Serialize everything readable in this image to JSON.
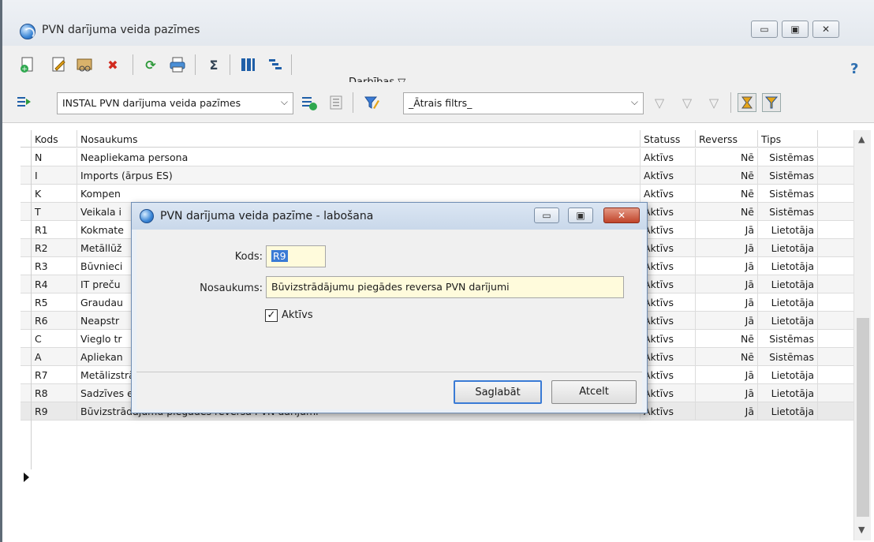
{
  "window": {
    "title": "PVN darījuma veida pazīmes",
    "controls": [
      "minimize",
      "maximize",
      "close"
    ]
  },
  "toolbar1": {
    "tools": [
      "add-icon",
      "edit-icon",
      "copy-icon",
      "delete-icon",
      "refresh-icon",
      "print-icon",
      "sum-icon",
      "columns-icon",
      "tree-icon"
    ],
    "actions_label": "Darbības ▽",
    "help": "?"
  },
  "toolbar2": {
    "view_select": "INSTAL PVN darījuma veida pazīmes",
    "quick_filter": "_Ātrais filtrs_"
  },
  "table": {
    "columns": [
      "Kods",
      "Nosaukums",
      "Statuss",
      "Reverss",
      "Tips"
    ],
    "rows": [
      {
        "kods": "N",
        "nosaukums": "Neapliekama persona",
        "statuss": "Aktīvs",
        "reverss": "Nē",
        "tips": "Sistēmas"
      },
      {
        "kods": "I",
        "nosaukums": "Imports (ārpus ES)",
        "statuss": "Aktīvs",
        "reverss": "Nē",
        "tips": "Sistēmas"
      },
      {
        "kods": "K",
        "nosaukums": "Kompen",
        "statuss": "Aktīvs",
        "reverss": "Nē",
        "tips": "Sistēmas"
      },
      {
        "kods": "T",
        "nosaukums": "Veikala i",
        "statuss": "Aktīvs",
        "reverss": "Nē",
        "tips": "Sistēmas"
      },
      {
        "kods": "R1",
        "nosaukums": "Kokmate",
        "statuss": "Aktīvs",
        "reverss": "Jā",
        "tips": "Lietotāja"
      },
      {
        "kods": "R2",
        "nosaukums": "Metāllūž",
        "statuss": "Aktīvs",
        "reverss": "Jā",
        "tips": "Lietotāja"
      },
      {
        "kods": "R3",
        "nosaukums": "Būvnieci",
        "statuss": "Aktīvs",
        "reverss": "Jā",
        "tips": "Lietotāja"
      },
      {
        "kods": "R4",
        "nosaukums": "IT preču",
        "statuss": "Aktīvs",
        "reverss": "Jā",
        "tips": "Lietotāja"
      },
      {
        "kods": "R5",
        "nosaukums": "Graudau",
        "statuss": "Aktīvs",
        "reverss": "Jā",
        "tips": "Lietotāja"
      },
      {
        "kods": "R6",
        "nosaukums": "Neapstr",
        "statuss": "Aktīvs",
        "reverss": "Jā",
        "tips": "Lietotāja"
      },
      {
        "kods": "C",
        "nosaukums": "Vieglo tr",
        "statuss": "Aktīvs",
        "reverss": "Nē",
        "tips": "Sistēmas"
      },
      {
        "kods": "A",
        "nosaukums": "Apliekan",
        "statuss": "Aktīvs",
        "reverss": "Nē",
        "tips": "Sistēmas"
      },
      {
        "kods": "R7",
        "nosaukums": "Metālizstrādājumu reversa PVN darījumi",
        "statuss": "Aktīvs",
        "reverss": "Jā",
        "tips": "Lietotāja"
      },
      {
        "kods": "R8",
        "nosaukums": "Sadzīves elektronisko iekārtu un sadzīves elektriskās aparatūras piegādes reversa PVN darījumi",
        "statuss": "Aktīvs",
        "reverss": "Jā",
        "tips": "Lietotāja"
      },
      {
        "kods": "R9",
        "nosaukums": "Būvizstrādājumu piegādes reversa PVN darījumi",
        "statuss": "Aktīvs",
        "reverss": "Jā",
        "tips": "Lietotāja"
      }
    ],
    "selected_row": "R9"
  },
  "dialog": {
    "title": "PVN darījuma veida pazīme - labošana",
    "kods_label": "Kods:",
    "kods_value": "R9",
    "nosaukums_label": "Nosaukums:",
    "nosaukums_value": "Būvizstrādājumu piegādes reversa PVN darījumi",
    "aktivs_label": "Aktīvs",
    "aktivs_checked": true,
    "save_label": "Saglabāt",
    "cancel_label": "Atcelt"
  },
  "colors": {
    "accent": "#3a7bd5",
    "field_bg": "#fffbdc",
    "close_btn": "#c0442a"
  }
}
